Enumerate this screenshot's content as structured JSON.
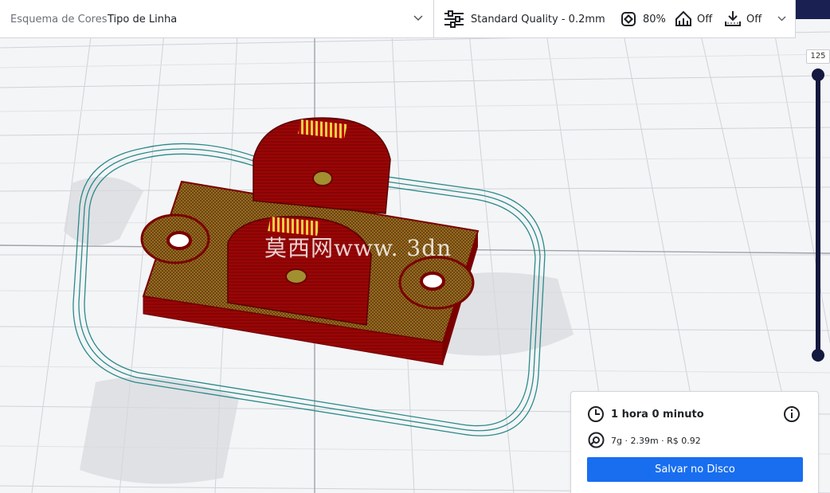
{
  "color_scheme": {
    "label": "Esquema de Cores",
    "value": "Tipo de Linha"
  },
  "print_settings": {
    "profile": "Standard Quality - 0.2mm",
    "infill": "80%",
    "support": "Off",
    "adhesion": "Off"
  },
  "layer_slider": {
    "current_layer": "125"
  },
  "print_info": {
    "time": "1 hora 0 minuto",
    "material": "7g · 2.39m · R$ 0.92",
    "save_label": "Salvar no Disco"
  },
  "watermark": "莫西网www. 3dn",
  "colors": {
    "accent": "#196ef0",
    "slider": "#14193f",
    "part_red": "#8b0000",
    "infill_olive": "#8a7a1f",
    "skirt": "#2a8a8a"
  },
  "icons": [
    "settings-sliders-icon",
    "infill-icon",
    "support-icon",
    "adhesion-icon",
    "clock-icon",
    "spool-icon",
    "info-icon",
    "chevron-down-icon"
  ]
}
